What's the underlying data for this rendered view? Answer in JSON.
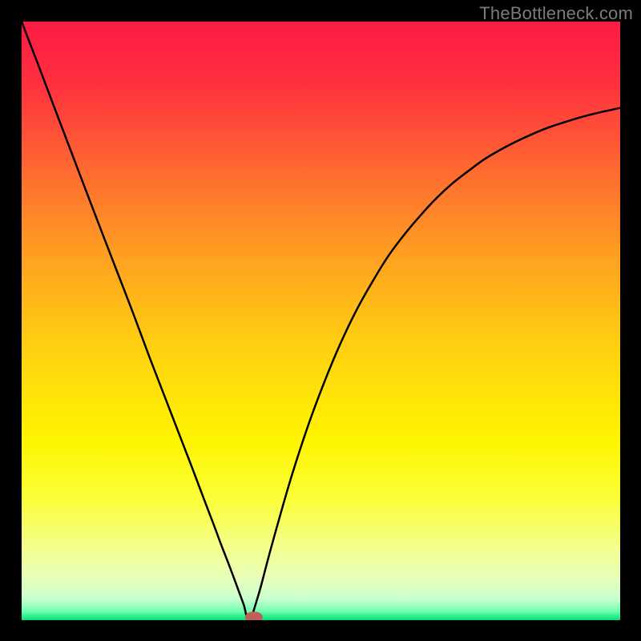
{
  "watermark": "TheBottleneck.com",
  "chart_data": {
    "type": "line",
    "title": "",
    "xlabel": "",
    "ylabel": "",
    "xlim": [
      0,
      100
    ],
    "ylim": [
      0,
      100
    ],
    "gradient_stops": [
      {
        "offset": 0.0,
        "color": "#ff1a44"
      },
      {
        "offset": 0.1,
        "color": "#ff2f3f"
      },
      {
        "offset": 0.25,
        "color": "#ff6a30"
      },
      {
        "offset": 0.4,
        "color": "#ffa320"
      },
      {
        "offset": 0.55,
        "color": "#ffd210"
      },
      {
        "offset": 0.7,
        "color": "#fff500"
      },
      {
        "offset": 0.8,
        "color": "#faff3a"
      },
      {
        "offset": 0.88,
        "color": "#f4ff8e"
      },
      {
        "offset": 0.93,
        "color": "#e8ffba"
      },
      {
        "offset": 0.965,
        "color": "#c8ffd0"
      },
      {
        "offset": 0.985,
        "color": "#70ffb0"
      },
      {
        "offset": 1.0,
        "color": "#00e17a"
      }
    ],
    "series": [
      {
        "name": "curve",
        "x": [
          0.0,
          2.5,
          5.3,
          8.0,
          10.7,
          13.3,
          16.0,
          18.7,
          21.3,
          24.0,
          26.7,
          28.7,
          30.7,
          32.0,
          33.3,
          34.7,
          36.0,
          37.1,
          38.0,
          39.5,
          41.3,
          43.3,
          45.3,
          48.0,
          50.7,
          53.3,
          56.0,
          58.7,
          61.3,
          64.0,
          66.7,
          69.3,
          72.0,
          74.7,
          77.3,
          80.0,
          82.7,
          85.3,
          88.0,
          90.7,
          93.3,
          96.0,
          98.7,
          100.0
        ],
        "y": [
          100.0,
          93.5,
          86.1,
          79.0,
          71.9,
          65.1,
          58.1,
          51.1,
          44.1,
          37.1,
          30.1,
          24.9,
          19.6,
          16.2,
          12.7,
          9.1,
          5.6,
          2.6,
          0.0,
          4.0,
          10.7,
          17.9,
          24.7,
          32.9,
          40.1,
          46.3,
          51.9,
          56.7,
          60.9,
          64.5,
          67.7,
          70.5,
          73.0,
          75.1,
          77.0,
          78.6,
          80.0,
          81.2,
          82.3,
          83.2,
          84.0,
          84.7,
          85.3,
          85.6
        ]
      }
    ],
    "marker": {
      "x": 38.8,
      "y": 0.5,
      "color": "#c06058"
    }
  }
}
